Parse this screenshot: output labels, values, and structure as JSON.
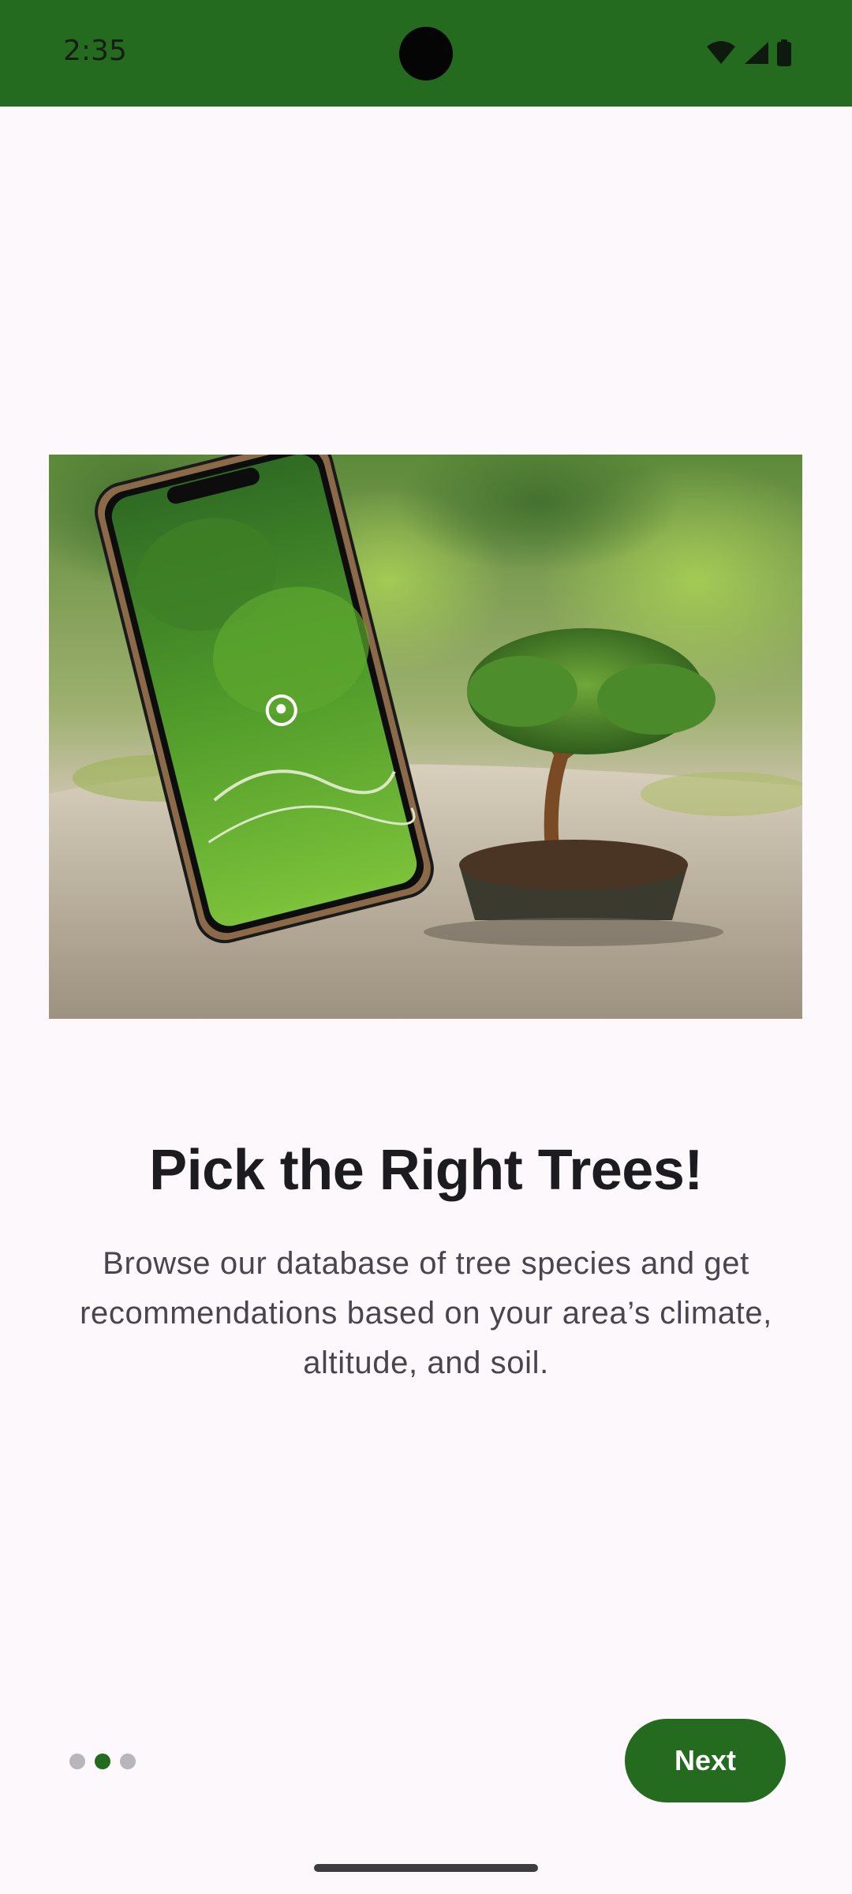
{
  "status_bar": {
    "time": "2:35",
    "background_color": "#246b1f",
    "icons": [
      "wifi-icon",
      "cell-signal-icon",
      "battery-icon"
    ]
  },
  "onboarding": {
    "image_description": "phone with forest map beside a bonsai tree",
    "title": "Pick the Right Trees!",
    "description": "Browse our database of tree species and get recommendations based on your area’s climate, altitude, and soil.",
    "page_indicator": {
      "total_pages": 3,
      "current_page": 2
    },
    "next_label": "Next"
  },
  "colors": {
    "accent": "#246b1f",
    "background": "#fdf8fb",
    "title": "#1c1b1f",
    "body_text": "#49454f",
    "dot_inactive": "#b8b6ba"
  }
}
